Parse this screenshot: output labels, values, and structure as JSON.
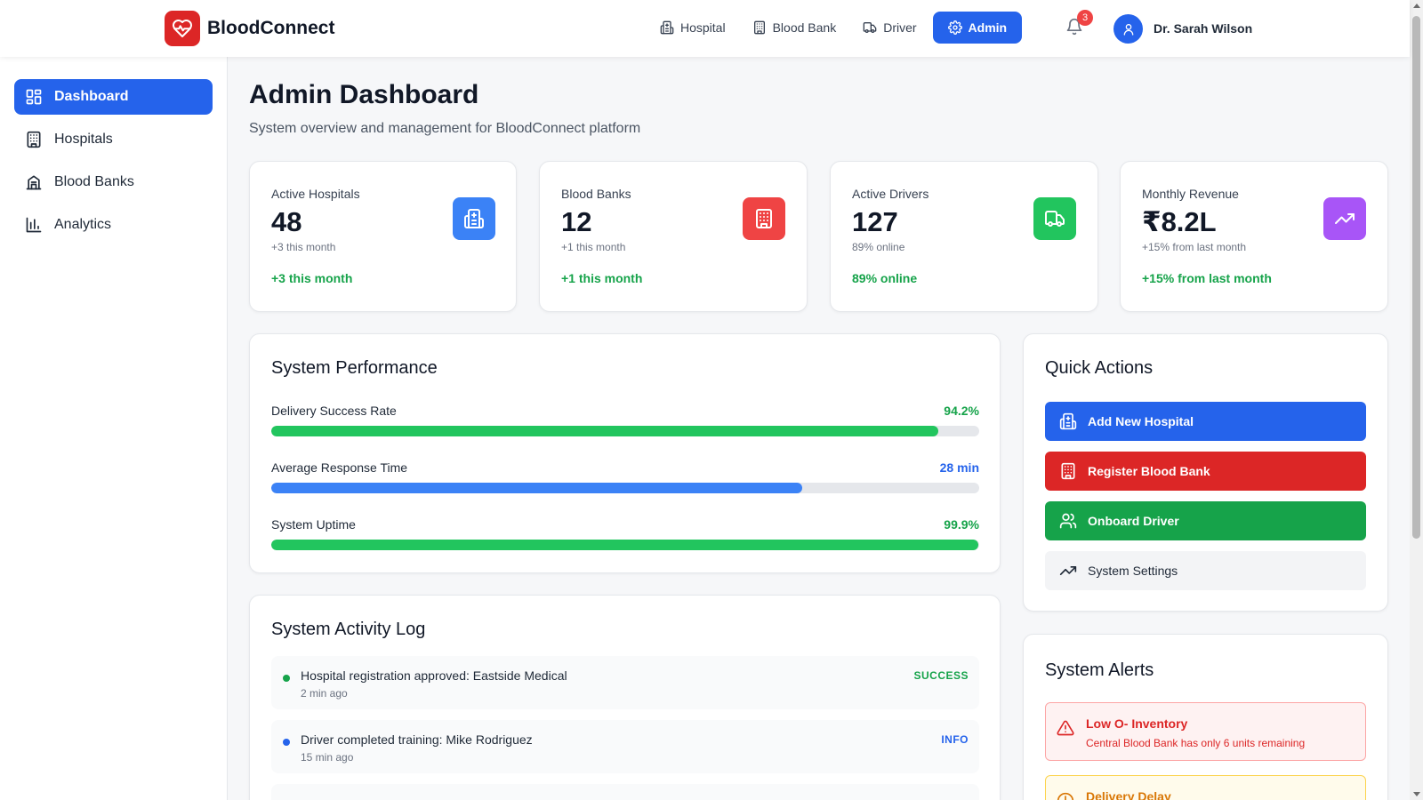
{
  "header": {
    "brand": "BloodConnect",
    "nav": [
      {
        "label": "Hospital",
        "icon": "hospital-icon"
      },
      {
        "label": "Blood Bank",
        "icon": "building-icon"
      },
      {
        "label": "Driver",
        "icon": "truck-icon"
      },
      {
        "label": "Admin",
        "icon": "gear-icon",
        "active": true
      }
    ],
    "notification_count": "3",
    "user_name": "Dr. Sarah Wilson"
  },
  "sidebar": {
    "items": [
      {
        "label": "Dashboard",
        "icon": "dashboard-icon",
        "active": true
      },
      {
        "label": "Hospitals",
        "icon": "building-icon"
      },
      {
        "label": "Blood Banks",
        "icon": "bank-icon"
      },
      {
        "label": "Analytics",
        "icon": "bar-chart-icon"
      }
    ]
  },
  "page": {
    "title": "Admin Dashboard",
    "subtitle": "System overview and management for BloodConnect platform"
  },
  "stats": [
    {
      "label": "Active Hospitals",
      "value": "48",
      "note": "+3 this month",
      "trend": "+3 this month",
      "color": "#3b82f6",
      "icon": "hospital-icon"
    },
    {
      "label": "Blood Banks",
      "value": "12",
      "note": "+1 this month",
      "trend": "+1 this month",
      "color": "#ef4444",
      "icon": "building-icon"
    },
    {
      "label": "Active Drivers",
      "value": "127",
      "note": "89% online",
      "trend": "89% online",
      "color": "#22c55e",
      "icon": "truck-icon"
    },
    {
      "label": "Monthly Revenue",
      "value": "₹8.2L",
      "note": "+15% from last month",
      "trend": "+15% from last month",
      "color": "#a855f7",
      "icon": "trending-up-icon"
    }
  ],
  "performance": {
    "title": "System Performance",
    "rows": [
      {
        "label": "Delivery Success Rate",
        "value": "94.2%",
        "level": 0.942,
        "color": "#22c55e",
        "value_color": "#16a34a"
      },
      {
        "label": "Average Response Time",
        "value": "28 min",
        "level": 0.75,
        "color": "#3b82f6",
        "value_color": "#2563eb"
      },
      {
        "label": "System Uptime",
        "value": "99.9%",
        "level": 0.999,
        "color": "#22c55e",
        "value_color": "#16a34a"
      }
    ]
  },
  "activity": {
    "title": "System Activity Log",
    "items": [
      {
        "text": "Hospital registration approved: Eastside Medical",
        "time": "2 min ago",
        "status": "SUCCESS",
        "color": "#16a34a"
      },
      {
        "text": "Driver completed training: Mike Rodriguez",
        "time": "15 min ago",
        "status": "INFO",
        "color": "#2563eb"
      }
    ]
  },
  "quick_actions": {
    "title": "Quick Actions",
    "buttons": [
      {
        "label": "Add New Hospital",
        "icon": "hospital-icon",
        "color": "#2563eb"
      },
      {
        "label": "Register Blood Bank",
        "icon": "building-icon",
        "color": "#dc2626"
      },
      {
        "label": "Onboard Driver",
        "icon": "users-icon",
        "color": "#16a34a"
      },
      {
        "label": "System Settings",
        "icon": "trending-up-icon",
        "color": "#f3f4f6"
      }
    ]
  },
  "alerts": {
    "title": "System Alerts",
    "items": [
      {
        "title": "Low O- Inventory",
        "desc": "Central Blood Bank has only 6 units remaining",
        "color": "#dc2626",
        "bg": "#fef2f2",
        "border": "#fca5a5"
      },
      {
        "title": "Delivery Delay",
        "color": "#d97706",
        "bg": "#fffbeb",
        "border": "#fcd34d"
      }
    ]
  }
}
